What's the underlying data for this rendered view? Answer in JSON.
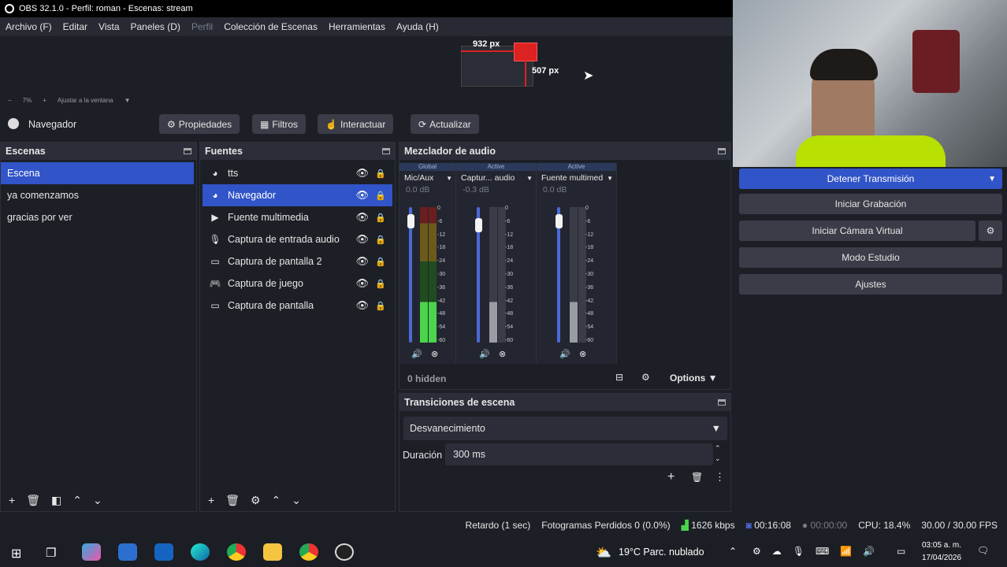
{
  "titlebar": {
    "text": "OBS 32.1.0 - Perfil: roman - Escenas: stream"
  },
  "menu": {
    "items": [
      "Archivo (F)",
      "Editar",
      "Vista",
      "Paneles (D)",
      "Perfil",
      "Colección de Escenas",
      "Herramientas",
      "Ayuda (H)"
    ]
  },
  "preview": {
    "width_label": "932 px",
    "height_label": "507 px"
  },
  "zoombar": {
    "minus": "−",
    "zoom": "7%",
    "plus": "+",
    "fit": "Ajustar a la ventana"
  },
  "context": {
    "source_name": "Navegador",
    "properties": "Propiedades",
    "filters": "Filtros",
    "interact": "Interactuar",
    "refresh": "Actualizar"
  },
  "scenes": {
    "title": "Escenas",
    "items": [
      "Escena",
      "ya comenzamos",
      "gracias por ver"
    ],
    "selected": 0
  },
  "sources": {
    "title": "Fuentes",
    "items": [
      {
        "icon": "browser-icon",
        "label": "tts"
      },
      {
        "icon": "browser-icon",
        "label": "Navegador"
      },
      {
        "icon": "play-icon",
        "label": "Fuente multimedia"
      },
      {
        "icon": "microphone-icon",
        "label": "Captura de entrada audio"
      },
      {
        "icon": "monitor-icon",
        "label": "Captura de pantalla 2"
      },
      {
        "icon": "gamepad-icon",
        "label": "Captura de juego"
      },
      {
        "icon": "monitor-icon",
        "label": "Captura de pantalla"
      }
    ],
    "selected": 1
  },
  "mixer": {
    "title": "Mezclador de audio",
    "channels": [
      {
        "tag": "Global",
        "name": "Mic/Aux",
        "db": "0.0 dB",
        "muted": false,
        "level": 0.95
      },
      {
        "tag": "Active",
        "name": "Captur... audio",
        "db": "-0.3 dB",
        "muted": true,
        "level": 0.92
      },
      {
        "tag": "Active",
        "name": "Fuente multimed",
        "db": "0.0 dB",
        "muted": true,
        "level": 0.95
      }
    ],
    "scale": [
      "0",
      "-6",
      "-12",
      "-18",
      "-24",
      "-30",
      "-36",
      "-42",
      "-48",
      "-54",
      "-60"
    ],
    "hidden": "0 hidden",
    "options": "Options"
  },
  "transitions": {
    "title": "Transiciones de escena",
    "selected": "Desvanecimiento",
    "duration_label": "Duración",
    "duration": "300 ms"
  },
  "controls": {
    "stop_stream": "Detener Transmisión",
    "start_record": "Iniciar Grabación",
    "virtual_cam": "Iniciar Cámara Virtual",
    "studio": "Modo Estudio",
    "settings": "Ajustes"
  },
  "status": {
    "delay": "Retardo (1 sec)",
    "dropped": "Fotogramas Perdidos 0 (0.0%)",
    "bitrate": "1626 kbps",
    "stream_time": "00:16:08",
    "rec_time": "00:00:00",
    "cpu": "CPU: 18.4%",
    "fps": "30.00 / 30.00 FPS"
  },
  "taskbar": {
    "weather": "19°C  Parc. nublado",
    "time": "03:05 a. m.",
    "date": "17/04/2026"
  },
  "colors": {
    "accent": "#3154c8",
    "meter_green": "#4cd44c",
    "meter_red": "#d23a3a"
  }
}
